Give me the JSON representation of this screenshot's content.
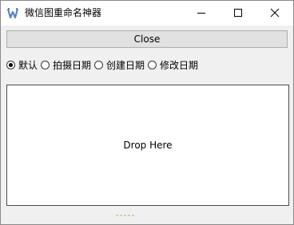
{
  "window": {
    "title": "微信图重命名神器",
    "app_icon": "w-logo-icon",
    "controls": {
      "minimize_icon": "minimize-icon",
      "maximize_icon": "maximize-icon",
      "close_icon": "close-icon"
    }
  },
  "toolbar": {
    "close_label": "Close"
  },
  "rename_mode": {
    "selected": "默认",
    "options": [
      "默认",
      "拍摄日期",
      "创建日期",
      "修改日期"
    ]
  },
  "drop_area": {
    "label": "Drop Here"
  },
  "colors": {
    "window_bg": "#f0f0f0",
    "button_bg": "#e1e1e1",
    "button_border": "#adadad",
    "app_icon_color": "#5b7fc7"
  }
}
